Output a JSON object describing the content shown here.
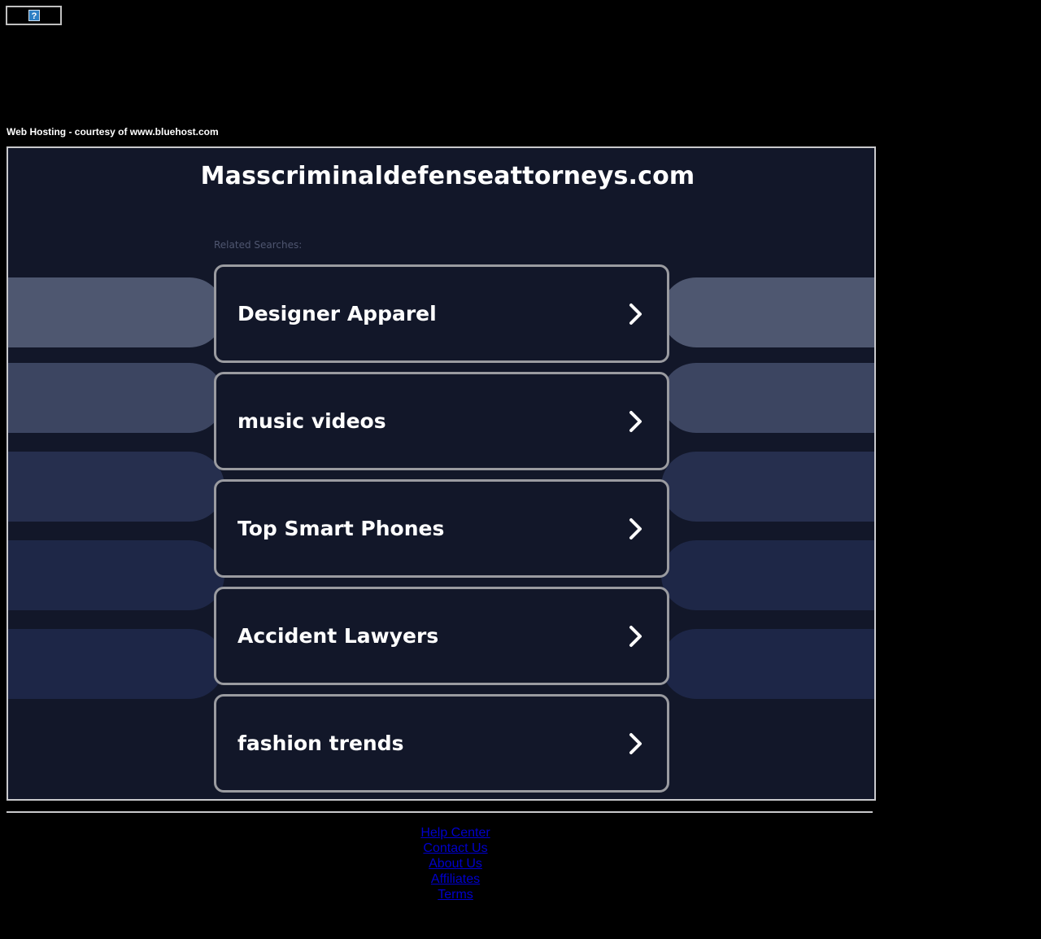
{
  "broken_image": {
    "icon": "broken-image-icon",
    "glyph": "?"
  },
  "hosting_text": "Web Hosting - courtesy of www.bluehost.com",
  "site_title": "Masscriminaldefenseattorneys.com",
  "related_label": "Related Searches:",
  "searches": [
    {
      "label": "Designer Apparel",
      "icon": "chevron-right-icon"
    },
    {
      "label": "music videos",
      "icon": "chevron-right-icon"
    },
    {
      "label": "Top Smart Phones",
      "icon": "chevron-right-icon"
    },
    {
      "label": "Accident Lawyers",
      "icon": "chevron-right-icon"
    },
    {
      "label": "fashion trends",
      "icon": "chevron-right-icon"
    }
  ],
  "pill_colors": [
    "#4e5770",
    "#3c4561",
    "#262f4e",
    "#1e2747",
    "#1d2647"
  ],
  "colors": {
    "page_bg": "#000000",
    "frame_bg": "#121729",
    "card_border": "#9a9ba0",
    "link": "#0000cc"
  },
  "footer_links": [
    "Help Center",
    "Contact Us",
    "About Us",
    "Affiliates",
    "Terms"
  ]
}
